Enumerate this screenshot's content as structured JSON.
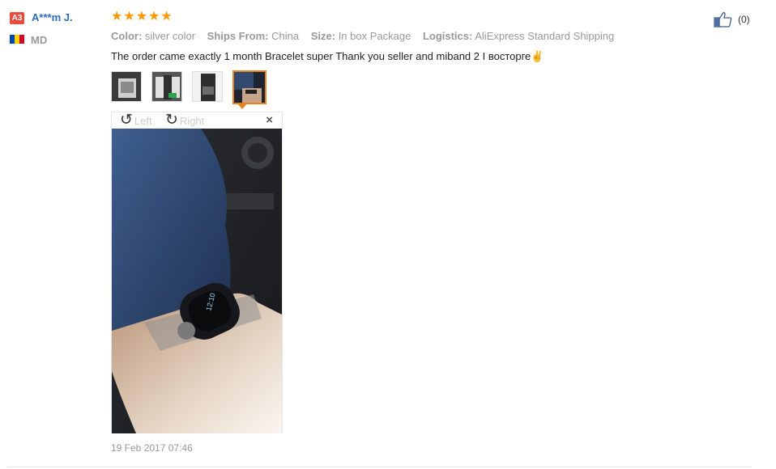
{
  "reviewer": {
    "level_badge": "A3",
    "name": "A***m J.",
    "country": "MD"
  },
  "rating": {
    "stars": 5,
    "max": 5
  },
  "attributes": [
    {
      "label": "Color:",
      "value": "silver color"
    },
    {
      "label": "Ships From:",
      "value": "China"
    },
    {
      "label": "Size:",
      "value": "In box Package"
    },
    {
      "label": "Logistics:",
      "value": "AliExpress Standard Shipping"
    }
  ],
  "comment": "The order came exactly 1 month Bracelet super Thank you seller and miband 2 I восторге✌",
  "thumbnails": {
    "count": 4,
    "active_index": 3
  },
  "viewer": {
    "rotate_left_label": "Left",
    "rotate_right_label": "Right",
    "close_label": "×"
  },
  "watch_time": "12:10",
  "date": "19 Feb 2017 07:46",
  "helpful": {
    "count_label": "(0)"
  },
  "colors": {
    "star": "#ff9900",
    "name_link": "#2a6dba",
    "badge": "#e64b3c",
    "active_thumb": "#e5841f"
  }
}
